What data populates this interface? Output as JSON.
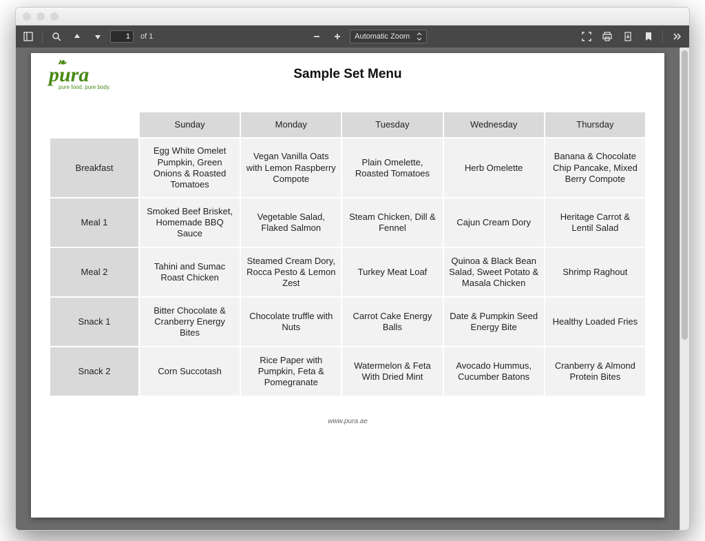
{
  "window": {
    "title": ""
  },
  "toolbar": {
    "page_value": "1",
    "page_total_prefix": "of ",
    "page_total": "1",
    "zoom_mode": "Automatic Zoom"
  },
  "logo": {
    "name": "pura",
    "tagline": "pure food. pure body."
  },
  "doc": {
    "title": "Sample Set Menu",
    "footer": "www.pura.ae"
  },
  "table": {
    "days": [
      "Sunday",
      "Monday",
      "Tuesday",
      "Wednesday",
      "Thursday"
    ],
    "rows": [
      {
        "label": "Breakfast",
        "cells": [
          "Egg White Omelet Pumpkin, Green Onions & Roasted Tomatoes",
          "Vegan Vanilla Oats with Lemon Raspberry Compote",
          "Plain Omelette, Roasted Tomatoes",
          "Herb Omelette",
          "Banana & Chocolate Chip Pancake, Mixed Berry Compote"
        ]
      },
      {
        "label": "Meal 1",
        "cells": [
          "Smoked Beef Brisket, Homemade BBQ Sauce",
          "Vegetable Salad, Flaked Salmon",
          "Steam Chicken, Dill & Fennel",
          "Cajun Cream Dory",
          "Heritage Carrot & Lentil Salad"
        ]
      },
      {
        "label": "Meal 2",
        "cells": [
          "Tahini and Sumac Roast Chicken",
          "Steamed Cream Dory, Rocca Pesto & Lemon Zest",
          "Turkey Meat Loaf",
          "Quinoa & Black Bean Salad, Sweet Potato & Masala Chicken",
          "Shrimp Raghout"
        ]
      },
      {
        "label": "Snack 1",
        "cells": [
          "Bitter Chocolate & Cranberry Energy Bites",
          "Chocolate truffle with Nuts",
          "Carrot Cake Energy Balls",
          "Date & Pumpkin Seed Energy Bite",
          "Healthy Loaded Fries"
        ]
      },
      {
        "label": "Snack 2",
        "cells": [
          "Corn Succotash",
          "Rice Paper with Pumpkin, Feta & Pomegranate",
          "Watermelon & Feta With Dried Mint",
          "Avocado Hummus, Cucumber Batons",
          "Cranberry  & Almond Protein Bites"
        ]
      }
    ]
  }
}
